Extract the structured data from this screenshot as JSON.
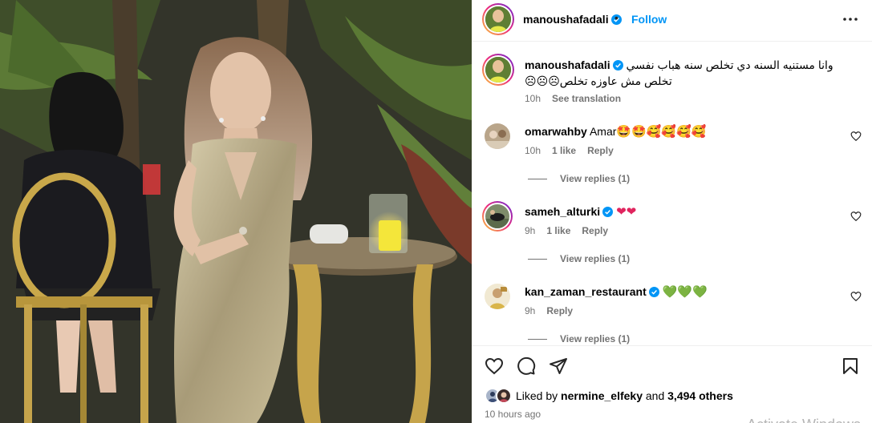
{
  "post": {
    "username": "manoushafadali",
    "follow_label": "Follow",
    "dot": "•"
  },
  "caption": {
    "username": "manoushafadali",
    "line1": "وانا مستنيه السنه دي تخلص سنه هباب نفسي",
    "line2": "تخلص مش عاوزه تخلص☹☹☹",
    "time": "10h",
    "translate": "See translation"
  },
  "comments": [
    {
      "username": "omarwahby",
      "text": "Amar",
      "emoji": "🤩🤩🥰🥰🥰🥰",
      "time": "10h",
      "likes": "1 like",
      "reply": "Reply",
      "view_replies": "View replies (1)"
    },
    {
      "username": "sameh_alturki",
      "text": "",
      "emoji": "❤❤",
      "time": "9h",
      "likes": "1 like",
      "reply": "Reply",
      "view_replies": "View replies (1)"
    },
    {
      "username": "kan_zaman_restaurant",
      "text": "",
      "emoji": "💚💚💚",
      "time": "9h",
      "likes": "",
      "reply": "Reply",
      "view_replies": "View replies (1)"
    }
  ],
  "likes": {
    "prefix": "Liked by",
    "user": "nermine_elfeky",
    "and": "and",
    "others": "3,494 others"
  },
  "posted_ago": "10 hours ago",
  "watermark": "Activate Windows",
  "icons": [
    "more-icon",
    "heart-icon",
    "comment-icon",
    "share-icon",
    "bookmark-icon",
    "verified-badge-icon"
  ],
  "colors": {
    "accent": "#0095f6",
    "verified": "#0095f6",
    "meta": "#737373"
  }
}
